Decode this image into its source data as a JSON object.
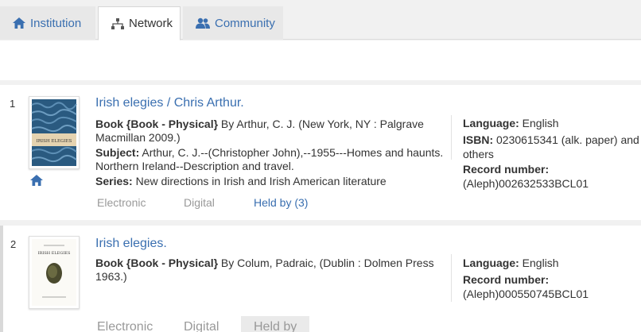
{
  "tabs": [
    {
      "label": "Institution",
      "icon": "home-icon",
      "active": false
    },
    {
      "label": "Network",
      "icon": "network-icon",
      "active": true
    },
    {
      "label": "Community",
      "icon": "users-icon",
      "active": false
    }
  ],
  "results": [
    {
      "number": "1",
      "title": "Irish elegies / Chris Arthur.",
      "cover_title": "IRISH ELEGIES",
      "type_label": "Book",
      "type_detail": "{Book - Physical}",
      "details": " By Arthur, C. J. (New York, NY : Palgrave Macmillan 2009.)",
      "subject_label": "Subject:",
      "subject_value": " Arthur, C. J.--(Christopher John),--1955---Homes and haunts. Northern Ireland--Description and travel.",
      "series_label": "Series:",
      "series_value": " New directions in Irish and Irish American literature",
      "language_label": "Language:",
      "language_value": " English",
      "isbn_label": "ISBN:",
      "isbn_value": " 0230615341 (alk. paper) and others",
      "record_label": "Record number:",
      "record_value": "(Aleph)002632533BCL01",
      "links": {
        "electronic": "Electronic",
        "digital": "Digital",
        "held": "Held by (3)"
      }
    },
    {
      "number": "2",
      "title": "Irish elegies.",
      "cover_title": "IRISH ELEGIES",
      "type_label": "Book",
      "type_detail": "{Book - Physical}",
      "details": " By Colum, Padraic, (Dublin : Dolmen Press 1963.)",
      "language_label": "Language:",
      "language_value": " English",
      "record_label": "Record number:",
      "record_value": "(Aleph)000550745BCL01",
      "links": {
        "electronic": "Electronic",
        "digital": "Digital",
        "held": "Held by"
      }
    }
  ],
  "colors": {
    "link": "#3a6fb0",
    "muted": "#999999",
    "background": "#f1f1f1"
  }
}
